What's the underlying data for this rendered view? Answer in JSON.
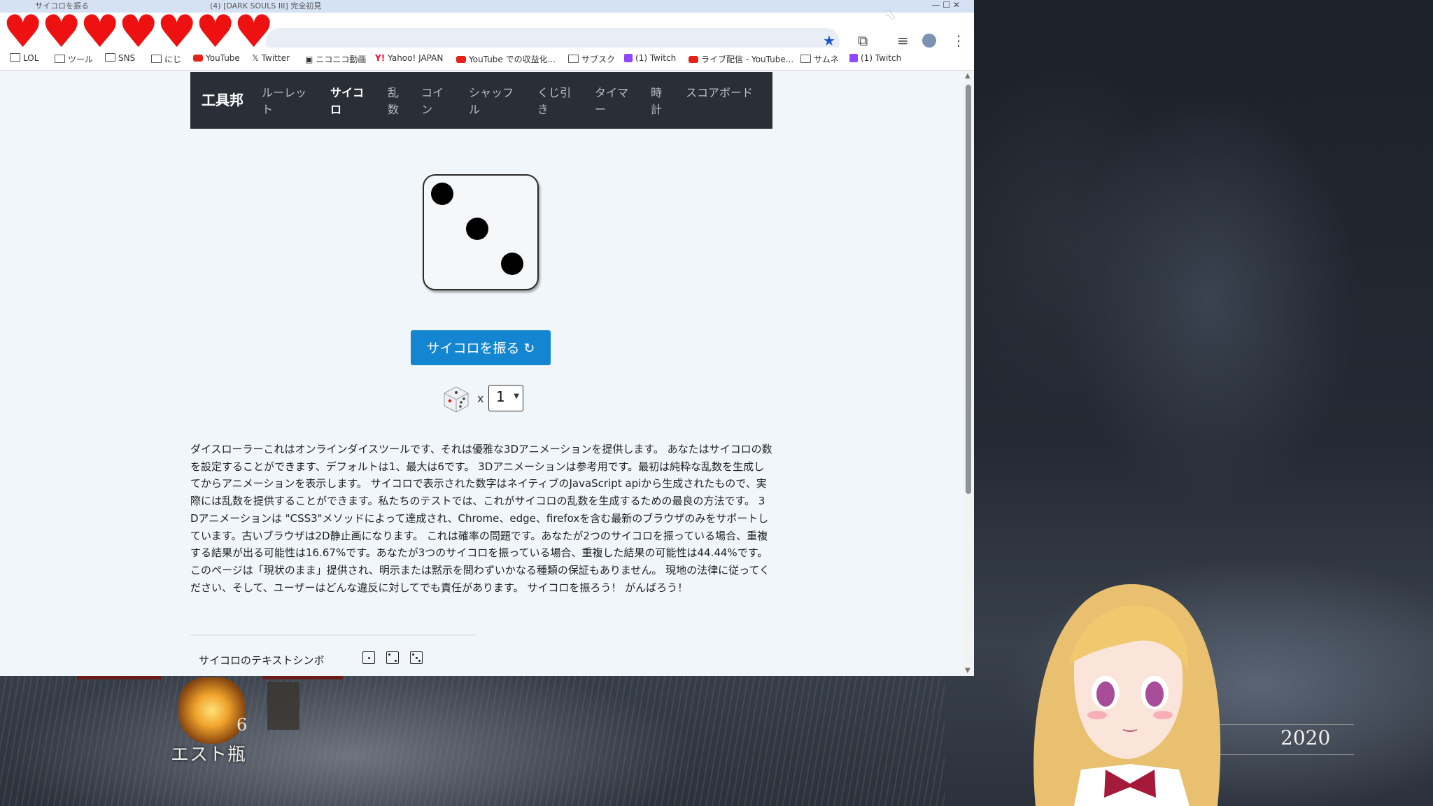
{
  "overlay": {
    "hearts": [
      "♥",
      "♥",
      "♥",
      "♥",
      "♥",
      "♥",
      "♥"
    ],
    "heart_color": "#ee1111"
  },
  "browser": {
    "tabs": [
      {
        "label": "サイコロを振る"
      },
      {
        "label": "(4) [DARK SOULS III] 完全初見"
      }
    ],
    "window_controls": "—   ☐   ✕",
    "toolbar_icons": [
      "star-icon",
      "extensions-icon",
      "reading-list-icon",
      "profile-icon",
      "menu-icon"
    ],
    "bookmarks": [
      {
        "label": "LOL",
        "icon": "folder"
      },
      {
        "label": "ツール",
        "icon": "folder"
      },
      {
        "label": "SNS",
        "icon": "folder"
      },
      {
        "label": "にじ",
        "icon": "folder"
      },
      {
        "label": "YouTube",
        "icon": "youtube"
      },
      {
        "label": "Twitter",
        "icon": "x"
      },
      {
        "label": "ニコニコ動画",
        "icon": "niconico"
      },
      {
        "label": "Yahoo! JAPAN",
        "icon": "yahoo"
      },
      {
        "label": "YouTube での収益化...",
        "icon": "youtube"
      },
      {
        "label": "サブスク",
        "icon": "folder"
      },
      {
        "label": "(1) Twitch",
        "icon": "twitch"
      },
      {
        "label": "ライブ配信 - YouTube...",
        "icon": "youtube"
      },
      {
        "label": "サムネ",
        "icon": "folder"
      },
      {
        "label": "(1) Twitch",
        "icon": "twitch"
      }
    ]
  },
  "site": {
    "brand": "工具邦",
    "nav": [
      {
        "label": "ルーレット",
        "active": false
      },
      {
        "label": "サイコロ",
        "active": true
      },
      {
        "label": "乱数",
        "active": false
      },
      {
        "label": "コイン",
        "active": false
      },
      {
        "label": "シャッフル",
        "active": false
      },
      {
        "label": "くじ引き",
        "active": false
      },
      {
        "label": "タイマー",
        "active": false
      },
      {
        "label": "時計",
        "active": false
      },
      {
        "label": "スコアボード",
        "active": false
      }
    ],
    "die_value": 3,
    "roll_button": "サイコロを振る ↻",
    "times": "x",
    "dice_count": "1",
    "description": "ダイスローラーこれはオンラインダイスツールです、それは優雅な3Dアニメーションを提供します。 あなたはサイコロの数を設定することができます、デフォルトは1、最大は6です。 3Dアニメーションは参考用です。最初は純粋な乱数を生成してからアニメーションを表示します。 サイコロで表示された数字はネイティブのJavaScript apiから生成されたもので、実際には乱数を提供することができます。私たちのテストでは、これがサイコロの乱数を生成するための最良の方法です。 3Dアニメーションは \"CSS3\"メソッドによって達成され、Chrome、edge、firefoxを含む最新のブラウザのみをサポートしています。古いブラウザは2D静止画になります。 これは確率の問題です。あなたが2つのサイコロを振っている場合、重複する結果が出る可能性は16.67%です。あなたが3つのサイコロを振っている場合、重複した結果の可能性は44.44%です。 このページは「現状のまま」提供され、明示または黙示を問わずいかなる種類の保証もありません。 現地の法律に従ってください、そして、ユーザーはどんな違反に対してでも責任があります。 サイコロを振ろう！ がんばろう！",
    "symbols_label": "サイコロのテキストシンボ"
  },
  "game_hud": {
    "estus_count": "6",
    "estus_label": "エスト瓶",
    "souls": "2020"
  }
}
